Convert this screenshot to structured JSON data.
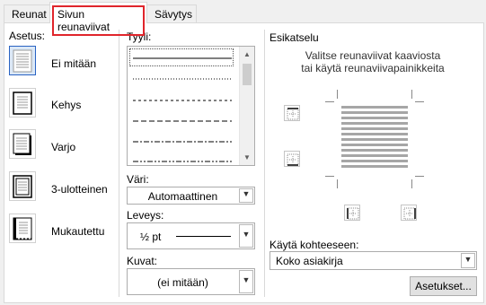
{
  "tabs": [
    {
      "label": "Reunat"
    },
    {
      "label": "Sivun reunaviivat"
    },
    {
      "label": "Sävytys"
    }
  ],
  "settings": {
    "heading": "Asetus:",
    "items": [
      {
        "label": "Ei mitään",
        "icon": "page-none-icon"
      },
      {
        "label": "Kehys",
        "icon": "page-box-icon"
      },
      {
        "label": "Varjo",
        "icon": "page-shadow-icon"
      },
      {
        "label": "3-ulotteinen",
        "icon": "page-3d-icon"
      },
      {
        "label": "Mukautettu",
        "icon": "page-custom-icon"
      }
    ]
  },
  "style": {
    "heading": "Tyyli:",
    "options": [
      "solid",
      "dotted",
      "dashed-short",
      "dashed",
      "dash-dot",
      "dash-dot-dot"
    ]
  },
  "color": {
    "heading": "Väri:",
    "value": "Automaattinen"
  },
  "width": {
    "heading": "Leveys:",
    "value": "½ pt"
  },
  "art": {
    "heading": "Kuvat:",
    "value": "(ei mitään)"
  },
  "preview": {
    "heading": "Esikatselu",
    "hint_line1": "Valitse reunaviivat kaaviosta",
    "hint_line2": "tai käytä reunaviivapainikkeita"
  },
  "apply_to": {
    "heading": "Käytä kohteeseen:",
    "value": "Koko asiakirja"
  },
  "options_button": "Asetukset...",
  "colors": {
    "accent_red": "#e0252b",
    "selection_blue": "#2a63c2"
  }
}
